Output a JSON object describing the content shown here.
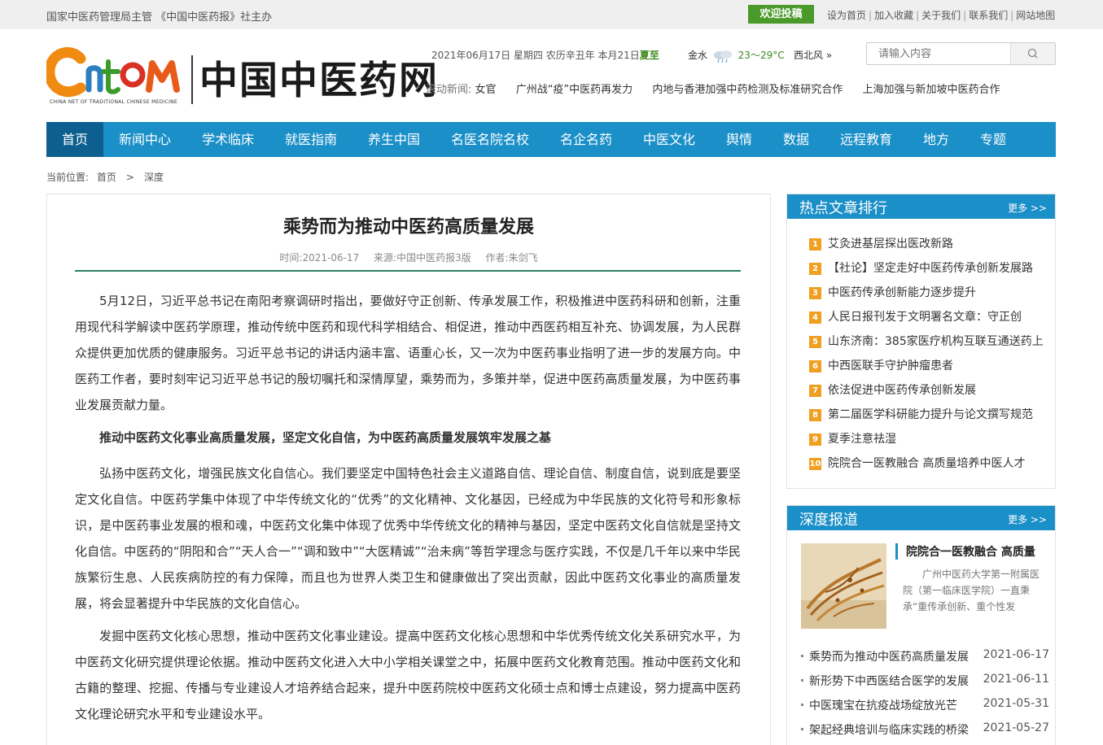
{
  "topbar": {
    "sponsor": "国家中医药管理局主管 《中国中医药报》社主办",
    "contribute": "欢迎投稿",
    "links": [
      "设为首页",
      "加入收藏",
      "关于我们",
      "联系我们",
      "网站地图"
    ]
  },
  "logo": {
    "en": "CHINA NET OF TRADITIONAL CHINESE MEDICINE",
    "zh": "中国中医药网"
  },
  "date": {
    "text": "2021年06月17日 星期四 农历辛丑年 本月21日",
    "solar_term": "夏至"
  },
  "weather": {
    "city": "金水",
    "temp": "23～29°C",
    "wind": "西北风",
    "more": "»"
  },
  "search": {
    "placeholder": "请输入内容"
  },
  "scroll_news": {
    "label": "滚动新闻:",
    "items": [
      "女官",
      "广州战“疫”中医药再发力",
      "内地与香港加强中药检测及标准研究合作",
      "上海加强与新加坡中医药合作"
    ]
  },
  "nav": [
    "首页",
    "新闻中心",
    "学术临床",
    "就医指南",
    "养生中国",
    "名医名院名校",
    "名企名药",
    "中医文化",
    "舆情",
    "数据",
    "远程教育",
    "地方",
    "专题"
  ],
  "breadcrumb": {
    "label": "当前位置:",
    "home": "首页",
    "sep": ">",
    "current": "深度"
  },
  "article": {
    "title": "乘势而为推动中医药高质量发展",
    "time": "时间:2021-06-17",
    "source": "来源:中国中医药报3版",
    "author": "作者:朱剑飞",
    "p1": "5月12日，习近平总书记在南阳考察调研时指出，要做好守正创新、传承发展工作，积极推进中医药科研和创新，注重用现代科学解读中医药学原理，推动传统中医药和现代科学相结合、相促进，推动中西医药相互补充、协调发展，为人民群众提供更加优质的健康服务。习近平总书记的讲话内涵丰富、语重心长，又一次为中医药事业指明了进一步的发展方向。中医药工作者，要时刻牢记习近平总书记的殷切嘱托和深情厚望，乘势而为，多策并举，促进中医药高质量发展，为中医药事业发展贡献力量。",
    "sub1": "推动中医药文化事业高质量发展，坚定文化自信，为中医药高质量发展筑牢发展之基",
    "p2": "弘扬中医药文化，增强民族文化自信心。我们要坚定中国特色社会主义道路自信、理论自信、制度自信，说到底是要坚定文化自信。中医药学集中体现了中华传统文化的“优秀”的文化精神、文化基因，已经成为中华民族的文化符号和形象标识，是中医药事业发展的根和魂，中医药文化集中体现了优秀中华传统文化的精神与基因，坚定中医药文化自信就是坚持文化自信。中医药的“阴阳和合”“天人合一”“调和致中”“大医精诚”“治未病”等哲学理念与医疗实践，不仅是几千年以来中华民族繁衍生息、人民疾病防控的有力保障，而且也为世界人类卫生和健康做出了突出贡献，因此中医药文化事业的高质量发展，将会显著提升中华民族的文化自信心。",
    "p3": "发掘中医药文化核心思想，推动中医药文化事业建设。提高中医药文化核心思想和中华优秀传统文化关系研究水平，为中医药文化研究提供理论依据。推动中医药文化进入大中小学相关课堂之中，拓展中医药文化教育范围。推动中医药文化和古籍的整理、挖掘、传播与专业建设人才培养结合起来，提升中医药院校中医药文化硕士点和博士点建设，努力提高中医药文化理论研究水平和专业建设水平。"
  },
  "hot": {
    "title": "热点文章排行",
    "more": "更多 >>",
    "items": [
      {
        "n": "1",
        "t": "艾灸进基层探出医改新路"
      },
      {
        "n": "2",
        "t": "【社论】坚定走好中医药传承创新发展路"
      },
      {
        "n": "3",
        "t": "中医药传承创新能力逐步提升"
      },
      {
        "n": "4",
        "t": "人民日报刊发于文明署名文章：守正创"
      },
      {
        "n": "5",
        "t": "山东济南：385家医疗机构互联互通送药上"
      },
      {
        "n": "6",
        "t": "中西医联手守护肿瘤患者"
      },
      {
        "n": "7",
        "t": "依法促进中医药传承创新发展"
      },
      {
        "n": "8",
        "t": "第二届医学科研能力提升与论文撰写规范"
      },
      {
        "n": "9",
        "t": "夏季注意祛湿"
      },
      {
        "n": "10",
        "t": "院院合一医教融合 高质量培养中医人才"
      }
    ]
  },
  "deep": {
    "title": "深度报道",
    "more": "更多 >>",
    "feature_title": "院院合一医教融合 高质量",
    "feature_desc": "广州中医药大学第一附属医院（第一临床医学院）一直秉承“重传承创新、重个性发",
    "items": [
      {
        "t": "乘势而为推动中医药高质量发展",
        "d": "2021-06-17"
      },
      {
        "t": "新形势下中西医结合医学的发展",
        "d": "2021-06-11"
      },
      {
        "t": "中医瑰宝在抗疫战场绽放光芒",
        "d": "2021-05-31"
      },
      {
        "t": "架起经典培训与临床实践的桥梁",
        "d": "2021-05-27"
      }
    ]
  }
}
